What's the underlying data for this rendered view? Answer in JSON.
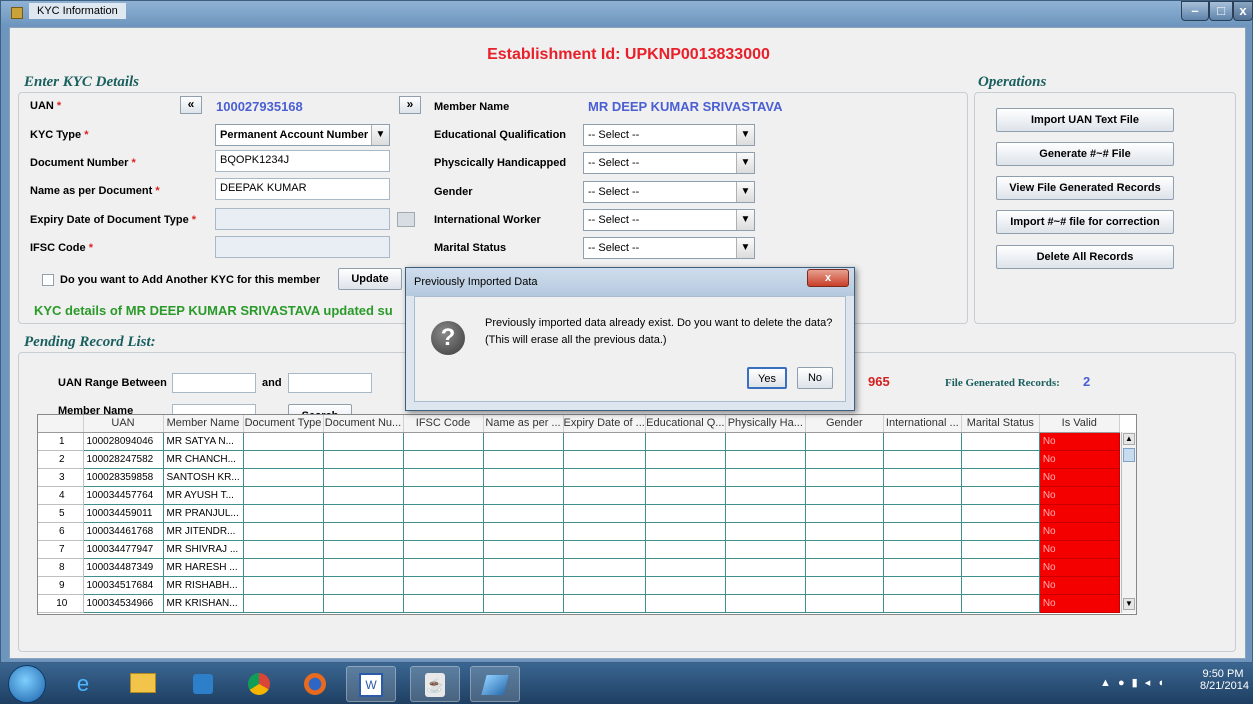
{
  "window": {
    "title": "KYC Information",
    "minimize": "–",
    "maximize": "□",
    "close": "x"
  },
  "establishment": "Establishment Id: UPKNP0013833000",
  "kyc": {
    "section_title": "Enter KYC Details",
    "uan_label": "UAN",
    "uan_value": "100027935168",
    "prev_symbol": "«",
    "next_symbol": "»",
    "kyc_type_label": "KYC Type",
    "kyc_type_value": "Permanent Account Number",
    "doc_num_label": "Document Number",
    "doc_num_value": "BQOPK1234J",
    "name_doc_label": "Name as per Document",
    "name_doc_value": "DEEPAK KUMAR",
    "expiry_label": "Expiry Date of Document Type",
    "ifsc_label": "IFSC Code",
    "add_another_label": "Do you want to Add Another KYC for this member",
    "update_label": "Update",
    "member_name_label": "Member Name",
    "member_name_value": "MR DEEP KUMAR SRIVASTAVA",
    "edu_label": "Educational Qualification",
    "ph_label": "Physcically Handicapped",
    "gender_label": "Gender",
    "intl_label": "International Worker",
    "marital_label": "Marital Status",
    "select_placeholder": "-- Select --",
    "status_message": "KYC details of MR DEEP KUMAR SRIVASTAVA updated su"
  },
  "operations": {
    "title": "Operations",
    "import_uan": "Import UAN Text File",
    "generate": "Generate #~# File",
    "view_generated": "View File Generated Records",
    "import_correction": "Import #~# file for correction",
    "delete_all": "Delete All Records"
  },
  "pending": {
    "title": "Pending Record List:",
    "uan_range_label": "UAN Range Between",
    "and_label": "and",
    "member_name_label": "Member Name",
    "search_label": "Search",
    "count_partial": "965",
    "file_generated_label": "File Generated Records:",
    "file_generated_value": "2"
  },
  "table": {
    "columns": [
      "UAN",
      "Member Name",
      "Document Type",
      "Document Nu...",
      "IFSC Code",
      "Name as per ...",
      "Expiry Date of ...",
      "Educational Q...",
      "Physically Ha...",
      "Gender",
      "International ...",
      "Marital Status",
      "Is Valid"
    ],
    "rows": [
      [
        "1",
        "100028094046",
        "MR SATYA N...",
        "No"
      ],
      [
        "2",
        "100028247582",
        "MR CHANCH...",
        "No"
      ],
      [
        "3",
        "100028359858",
        "SANTOSH KR...",
        "No"
      ],
      [
        "4",
        "100034457764",
        "MR AYUSH T...",
        "No"
      ],
      [
        "5",
        "100034459011",
        "MR PRANJUL...",
        "No"
      ],
      [
        "6",
        "100034461768",
        "MR JITENDR...",
        "No"
      ],
      [
        "7",
        "100034477947",
        "MR SHIVRAJ ...",
        "No"
      ],
      [
        "8",
        "100034487349",
        "MR HARESH ...",
        "No"
      ],
      [
        "9",
        "100034517684",
        "MR RISHABH...",
        "No"
      ],
      [
        "10",
        "100034534966",
        "MR KRISHAN...",
        "No"
      ]
    ]
  },
  "dialog": {
    "title": "Previously Imported Data",
    "message": "Previously imported data already exist. Do you want to delete the data?",
    "sub_message": "(This will erase all the previous data.)",
    "yes": "Yes",
    "no": "No",
    "close": "x",
    "icon_glyph": "?"
  },
  "taskbar": {
    "time": "9:50 PM",
    "date": "8/21/2014",
    "apps": [
      "windows-start",
      "internet-explorer",
      "file-explorer",
      "media-player",
      "chrome",
      "firefox",
      "word",
      "java",
      "app"
    ]
  }
}
